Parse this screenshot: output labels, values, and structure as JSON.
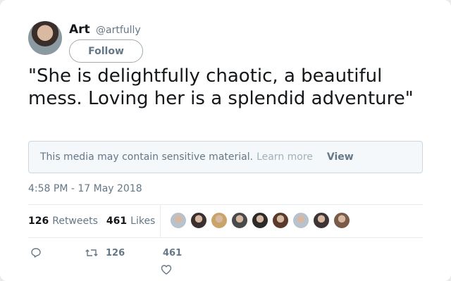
{
  "author": {
    "name": "Art",
    "handle": "@artfully",
    "follow_label": "Follow"
  },
  "tweet": {
    "text": "\"She is delightfully chaotic, a beautiful mess. Loving her is a splendid adventure\""
  },
  "sensitive_notice": {
    "message": "This media may contain sensitive material.",
    "learn_more": "Learn more",
    "view": "View"
  },
  "timestamp": "4:58 PM - 17 May 2018",
  "stats": {
    "retweets_count": "126",
    "retweets_label": "Retweets",
    "likes_count": "461",
    "likes_label": "Likes"
  },
  "liker_avatars": [
    {
      "color": "#b8c2cc"
    },
    {
      "color": "#3b2f2f"
    },
    {
      "color": "#c9a46a"
    },
    {
      "color": "#4a4a4a"
    },
    {
      "color": "#2e2a28"
    },
    {
      "color": "#5a3a2a"
    },
    {
      "color": "#b8c2cc"
    },
    {
      "color": "#3d3535"
    },
    {
      "color": "#7a5a48"
    }
  ],
  "actions": {
    "retweet_count": "126",
    "like_count": "461"
  },
  "icons": {
    "reply": "reply-icon",
    "retweet": "retweet-icon",
    "like": "heart-icon"
  }
}
